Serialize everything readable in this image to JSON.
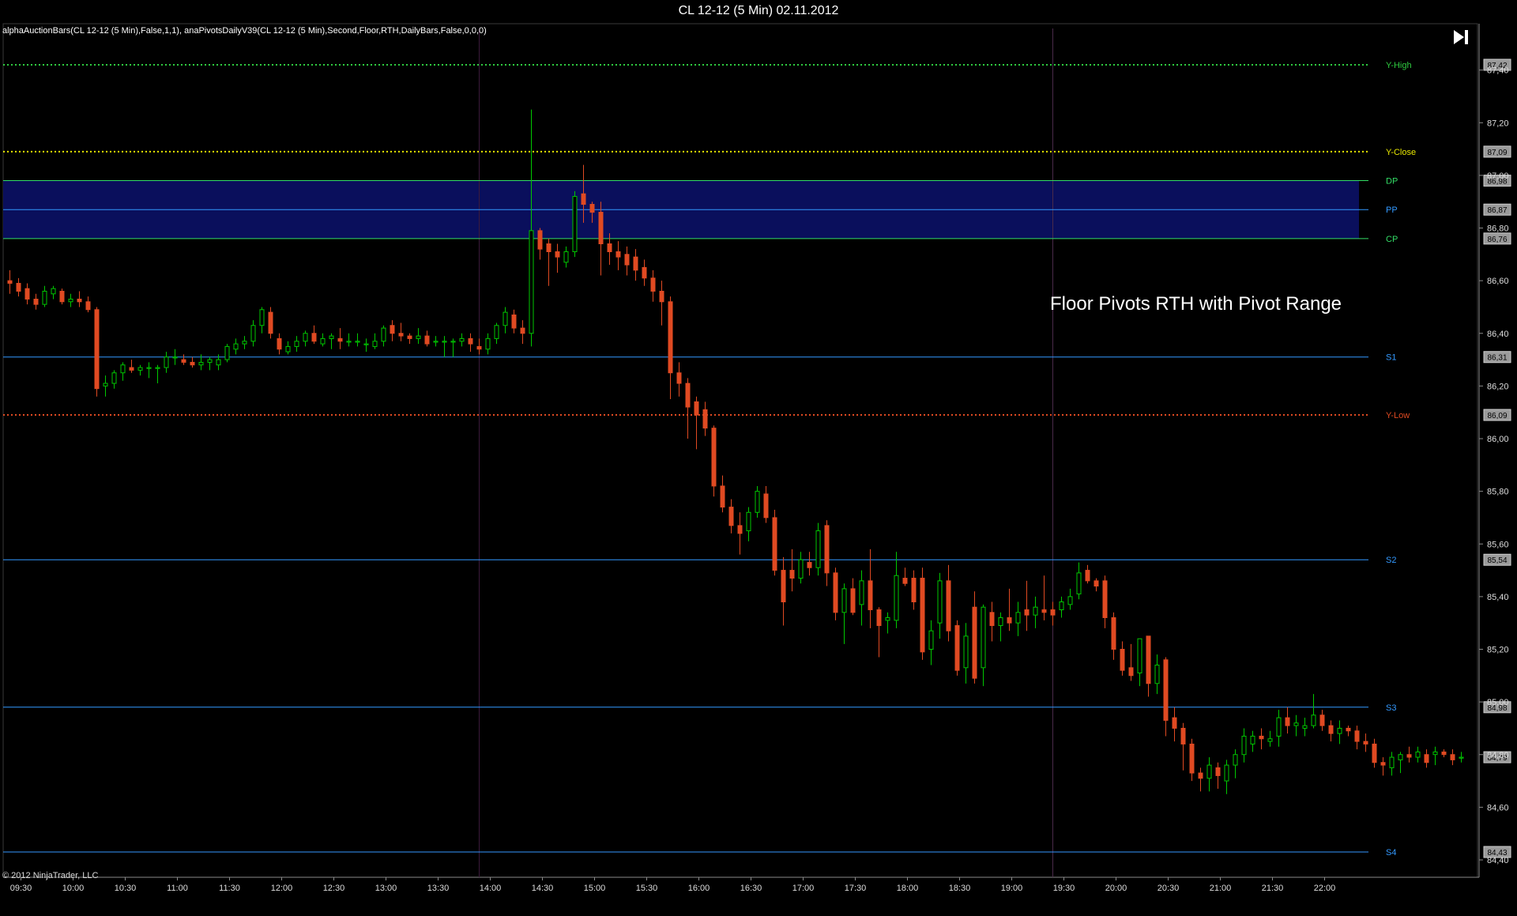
{
  "window": {
    "title": "CL 12-12 (5 Min)  02.11.2012",
    "indicators": "alphaAuctionBars(CL 12-12 (5 Min),False,1,1), anaPivotsDailyV39(CL 12-12 (5 Min),Second,Floor,RTH,DailyBars,False,0,0,0)",
    "copyright": "© 2012 NinjaTrader, LLC",
    "jump_button_icon": "skip-to-end-icon"
  },
  "colors": {
    "background": "#000000",
    "up_candle": "#00c800",
    "down_candle": "#e04a22",
    "pivot_range_fill": "#0a0f5c",
    "grid": "#1a1a1a"
  },
  "chart_data": {
    "type": "candlestick",
    "instrument": "CL 12-12",
    "interval": "5 Min",
    "date": "02.11.2012",
    "title": "CL 12-12 (5 Min)  02.11.2012",
    "annotation": "Floor Pivots RTH with Pivot Range",
    "y_axis": {
      "position": "right",
      "range": [
        84.4,
        87.48
      ],
      "ticks": [
        "87,40",
        "87,20",
        "87,00",
        "86,80",
        "86,60",
        "86,40",
        "86,20",
        "86,00",
        "85,80",
        "85,60",
        "85,40",
        "85,20",
        "85,00",
        "84,80",
        "84,60",
        "84,40"
      ],
      "tick_values": [
        87.4,
        87.2,
        87.0,
        86.8,
        86.6,
        86.4,
        86.2,
        86.0,
        85.8,
        85.6,
        85.4,
        85.2,
        85.0,
        84.8,
        84.6,
        84.4
      ]
    },
    "x_axis": {
      "ticks": [
        "09:30",
        "10:00",
        "10:30",
        "11:00",
        "11:30",
        "12:00",
        "12:30",
        "13:00",
        "13:30",
        "14:00",
        "14:30",
        "15:00",
        "15:30",
        "16:00",
        "16:30",
        "17:00",
        "17:30",
        "18:00",
        "18:30",
        "19:00",
        "19:30",
        "20:00",
        "20:30",
        "21:00",
        "21:30",
        "22:00"
      ],
      "bar_minutes": 5,
      "first_bar": "09:30",
      "last_bar": "22:10",
      "session_lines": [
        "14:00",
        "19:30"
      ]
    },
    "pivot_levels": [
      {
        "label": "Y-High",
        "value": 87.42,
        "price_label": "87,42",
        "color": "#2ecc40",
        "style": "dotted"
      },
      {
        "label": "Y-Close",
        "value": 87.09,
        "price_label": "87,09",
        "color": "#e6e600",
        "style": "dotted"
      },
      {
        "label": "DP",
        "value": 86.98,
        "price_label": "86,98",
        "color": "#33dd66",
        "style": "solid"
      },
      {
        "label": "PP",
        "value": 86.87,
        "price_label": "86,87",
        "color": "#3399ff",
        "style": "solid"
      },
      {
        "label": "CP",
        "value": 86.76,
        "price_label": "86,76",
        "color": "#33dd66",
        "style": "solid"
      },
      {
        "label": "S1",
        "value": 86.31,
        "price_label": "86,31",
        "color": "#3399ff",
        "style": "solid"
      },
      {
        "label": "Y-Low",
        "value": 86.09,
        "price_label": "86,09",
        "color": "#e04a22",
        "style": "dotted"
      },
      {
        "label": "S2",
        "value": 85.54,
        "price_label": "85,54",
        "color": "#3399ff",
        "style": "solid"
      },
      {
        "label": "S3",
        "value": 84.98,
        "price_label": "84,98",
        "color": "#3399ff",
        "style": "solid"
      },
      {
        "label": "S4",
        "value": 84.43,
        "price_label": "84,43",
        "color": "#3399ff",
        "style": "solid"
      }
    ],
    "last_price": {
      "value": 84.79,
      "price_label": "84,79"
    },
    "pivot_range": {
      "top": 86.98,
      "bottom": 86.76
    },
    "candles": [
      [
        86.6,
        86.64,
        86.55,
        86.59
      ],
      [
        86.59,
        86.61,
        86.54,
        86.56
      ],
      [
        86.57,
        86.59,
        86.51,
        86.53
      ],
      [
        86.53,
        86.55,
        86.49,
        86.51
      ],
      [
        86.51,
        86.58,
        86.5,
        86.56
      ],
      [
        86.55,
        86.58,
        86.53,
        86.57
      ],
      [
        86.56,
        86.57,
        86.51,
        86.52
      ],
      [
        86.52,
        86.55,
        86.5,
        86.53
      ],
      [
        86.53,
        86.56,
        86.5,
        86.52
      ],
      [
        86.52,
        86.54,
        86.48,
        86.49
      ],
      [
        86.49,
        86.5,
        86.16,
        86.19
      ],
      [
        86.2,
        86.24,
        86.16,
        86.21
      ],
      [
        86.21,
        86.26,
        86.19,
        86.25
      ],
      [
        86.25,
        86.29,
        86.22,
        86.28
      ],
      [
        86.27,
        86.3,
        86.25,
        86.26
      ],
      [
        86.26,
        86.28,
        86.24,
        86.27
      ],
      [
        86.27,
        86.29,
        86.23,
        86.27
      ],
      [
        86.27,
        86.28,
        86.21,
        86.27
      ],
      [
        86.27,
        86.33,
        86.25,
        86.31
      ],
      [
        86.31,
        86.34,
        86.28,
        86.31
      ],
      [
        86.3,
        86.32,
        86.28,
        86.29
      ],
      [
        86.29,
        86.31,
        86.27,
        86.28
      ],
      [
        86.28,
        86.32,
        86.26,
        86.29
      ],
      [
        86.29,
        86.31,
        86.26,
        86.3
      ],
      [
        86.28,
        86.32,
        86.26,
        86.3
      ],
      [
        86.3,
        86.36,
        86.29,
        86.35
      ],
      [
        86.34,
        86.38,
        86.32,
        86.36
      ],
      [
        86.36,
        86.39,
        86.34,
        86.37
      ],
      [
        86.37,
        86.45,
        86.35,
        86.43
      ],
      [
        86.43,
        86.5,
        86.4,
        86.49
      ],
      [
        86.48,
        86.5,
        86.38,
        86.4
      ],
      [
        86.38,
        86.4,
        86.32,
        86.34
      ],
      [
        86.33,
        86.37,
        86.32,
        86.35
      ],
      [
        86.35,
        86.39,
        86.33,
        86.37
      ],
      [
        86.37,
        86.41,
        86.35,
        86.4
      ],
      [
        86.4,
        86.43,
        86.36,
        86.37
      ],
      [
        86.36,
        86.4,
        86.35,
        86.38
      ],
      [
        86.38,
        86.4,
        86.34,
        86.39
      ],
      [
        86.38,
        86.42,
        86.34,
        86.37
      ],
      [
        86.37,
        86.4,
        86.35,
        86.37
      ],
      [
        86.37,
        86.4,
        86.35,
        86.37
      ],
      [
        86.36,
        86.38,
        86.33,
        86.36
      ],
      [
        86.35,
        86.4,
        86.34,
        86.37
      ],
      [
        86.37,
        86.43,
        86.35,
        86.42
      ],
      [
        86.43,
        86.45,
        86.37,
        86.4
      ],
      [
        86.4,
        86.44,
        86.37,
        86.39
      ],
      [
        86.39,
        86.4,
        86.36,
        86.38
      ],
      [
        86.38,
        86.42,
        86.36,
        86.39
      ],
      [
        86.39,
        86.41,
        86.35,
        86.36
      ],
      [
        86.37,
        86.39,
        86.35,
        86.37
      ],
      [
        86.37,
        86.39,
        86.31,
        86.37
      ],
      [
        86.37,
        86.38,
        86.31,
        86.37
      ],
      [
        86.37,
        86.4,
        86.35,
        86.38
      ],
      [
        86.38,
        86.4,
        86.33,
        86.36
      ],
      [
        86.35,
        86.38,
        86.32,
        86.34
      ],
      [
        86.34,
        86.4,
        86.32,
        86.38
      ],
      [
        86.38,
        86.44,
        86.36,
        86.43
      ],
      [
        86.43,
        86.5,
        86.4,
        86.48
      ],
      [
        86.47,
        86.49,
        86.4,
        86.42
      ],
      [
        86.42,
        86.45,
        86.36,
        86.4
      ],
      [
        86.4,
        87.25,
        86.35,
        86.79
      ],
      [
        86.79,
        86.8,
        86.68,
        86.72
      ],
      [
        86.74,
        86.76,
        86.58,
        86.71
      ],
      [
        86.71,
        86.74,
        86.63,
        86.69
      ],
      [
        86.67,
        86.73,
        86.65,
        86.71
      ],
      [
        86.71,
        86.94,
        86.69,
        86.92
      ],
      [
        86.93,
        87.04,
        86.82,
        86.89
      ],
      [
        86.89,
        86.9,
        86.82,
        86.86
      ],
      [
        86.86,
        86.9,
        86.62,
        86.74
      ],
      [
        86.74,
        86.78,
        86.66,
        86.71
      ],
      [
        86.71,
        86.75,
        86.64,
        86.69
      ],
      [
        86.7,
        86.73,
        86.62,
        86.66
      ],
      [
        86.69,
        86.72,
        86.6,
        86.64
      ],
      [
        86.65,
        86.68,
        86.58,
        86.61
      ],
      [
        86.61,
        86.64,
        86.52,
        86.56
      ],
      [
        86.56,
        86.6,
        86.43,
        86.52
      ],
      [
        86.52,
        86.54,
        86.15,
        86.25
      ],
      [
        86.25,
        86.29,
        86.16,
        86.21
      ],
      [
        86.21,
        86.23,
        86.0,
        86.12
      ],
      [
        86.14,
        86.16,
        85.96,
        86.09
      ],
      [
        86.11,
        86.14,
        86.01,
        86.04
      ],
      [
        86.04,
        86.05,
        85.78,
        85.82
      ],
      [
        85.82,
        85.86,
        85.72,
        85.74
      ],
      [
        85.74,
        85.77,
        85.64,
        85.67
      ],
      [
        85.67,
        85.72,
        85.56,
        85.64
      ],
      [
        85.65,
        85.74,
        85.61,
        85.72
      ],
      [
        85.72,
        85.82,
        85.7,
        85.8
      ],
      [
        85.79,
        85.82,
        85.68,
        85.7
      ],
      [
        85.7,
        85.73,
        85.48,
        85.5
      ],
      [
        85.5,
        85.55,
        85.29,
        85.38
      ],
      [
        85.5,
        85.58,
        85.42,
        85.47
      ],
      [
        85.47,
        85.57,
        85.45,
        85.54
      ],
      [
        85.53,
        85.57,
        85.48,
        85.51
      ],
      [
        85.51,
        85.68,
        85.48,
        85.65
      ],
      [
        85.67,
        85.69,
        85.44,
        85.49
      ],
      [
        85.49,
        85.51,
        85.31,
        85.34
      ],
      [
        85.34,
        85.45,
        85.22,
        85.43
      ],
      [
        85.43,
        85.47,
        85.33,
        85.34
      ],
      [
        85.37,
        85.5,
        85.29,
        85.46
      ],
      [
        85.46,
        85.58,
        85.28,
        85.35
      ],
      [
        85.35,
        85.36,
        85.17,
        85.29
      ],
      [
        85.31,
        85.34,
        85.26,
        85.32
      ],
      [
        85.31,
        85.57,
        85.28,
        85.48
      ],
      [
        85.47,
        85.51,
        85.44,
        85.45
      ],
      [
        85.47,
        85.5,
        85.35,
        85.38
      ],
      [
        85.47,
        85.51,
        85.16,
        85.19
      ],
      [
        85.2,
        85.31,
        85.14,
        85.27
      ],
      [
        85.3,
        85.49,
        85.24,
        85.46
      ],
      [
        85.46,
        85.52,
        85.23,
        85.27
      ],
      [
        85.29,
        85.31,
        85.1,
        85.12
      ],
      [
        85.13,
        85.3,
        85.07,
        85.25
      ],
      [
        85.36,
        85.42,
        85.07,
        85.09
      ],
      [
        85.13,
        85.37,
        85.06,
        85.36
      ],
      [
        85.34,
        85.38,
        85.23,
        85.29
      ],
      [
        85.29,
        85.34,
        85.23,
        85.32
      ],
      [
        85.32,
        85.43,
        85.27,
        85.3
      ],
      [
        85.3,
        85.38,
        85.25,
        85.34
      ],
      [
        85.35,
        85.46,
        85.27,
        85.33
      ],
      [
        85.33,
        85.4,
        85.28,
        85.36
      ],
      [
        85.35,
        85.48,
        85.31,
        85.34
      ],
      [
        85.35,
        85.38,
        85.29,
        85.33
      ],
      [
        85.35,
        85.4,
        85.32,
        85.38
      ],
      [
        85.37,
        85.43,
        85.35,
        85.4
      ],
      [
        85.41,
        85.53,
        85.39,
        85.49
      ],
      [
        85.5,
        85.52,
        85.45,
        85.46
      ],
      [
        85.46,
        85.47,
        85.42,
        85.44
      ],
      [
        85.46,
        85.48,
        85.28,
        85.32
      ],
      [
        85.32,
        85.34,
        85.16,
        85.2
      ],
      [
        85.2,
        85.23,
        85.1,
        85.12
      ],
      [
        85.13,
        85.22,
        85.08,
        85.1
      ],
      [
        85.11,
        85.23,
        85.06,
        85.24
      ],
      [
        85.25,
        85.25,
        85.02,
        85.07
      ],
      [
        85.07,
        85.18,
        85.03,
        85.14
      ],
      [
        85.16,
        85.17,
        84.87,
        84.93
      ],
      [
        84.94,
        84.98,
        84.85,
        84.9
      ],
      [
        84.9,
        84.92,
        84.74,
        84.84
      ],
      [
        84.84,
        84.86,
        84.7,
        84.73
      ],
      [
        84.73,
        84.75,
        84.66,
        84.71
      ],
      [
        84.71,
        84.79,
        84.66,
        84.76
      ],
      [
        84.75,
        84.77,
        84.67,
        84.72
      ],
      [
        84.7,
        84.78,
        84.65,
        84.76
      ],
      [
        84.76,
        84.82,
        84.71,
        84.8
      ],
      [
        84.8,
        84.9,
        84.77,
        84.87
      ],
      [
        84.84,
        84.89,
        84.81,
        84.87
      ],
      [
        84.87,
        84.9,
        84.82,
        84.86
      ],
      [
        84.85,
        84.89,
        84.83,
        84.86
      ],
      [
        84.87,
        84.97,
        84.83,
        84.94
      ],
      [
        84.94,
        84.98,
        84.88,
        84.91
      ],
      [
        84.91,
        84.95,
        84.87,
        84.92
      ],
      [
        84.9,
        84.94,
        84.87,
        84.91
      ],
      [
        84.91,
        85.03,
        84.9,
        84.95
      ],
      [
        84.95,
        84.97,
        84.89,
        84.91
      ],
      [
        84.91,
        84.93,
        84.85,
        84.88
      ],
      [
        84.88,
        84.93,
        84.84,
        84.9
      ],
      [
        84.9,
        84.91,
        84.87,
        84.89
      ],
      [
        84.89,
        84.91,
        84.82,
        84.85
      ],
      [
        84.85,
        84.88,
        84.81,
        84.84
      ],
      [
        84.84,
        84.86,
        84.75,
        84.77
      ],
      [
        84.77,
        84.79,
        84.72,
        84.76
      ],
      [
        84.75,
        84.81,
        84.72,
        84.79
      ],
      [
        84.78,
        84.81,
        84.73,
        84.8
      ],
      [
        84.8,
        84.83,
        84.77,
        84.79
      ],
      [
        84.79,
        84.83,
        84.77,
        84.81
      ],
      [
        84.8,
        84.82,
        84.75,
        84.77
      ],
      [
        84.8,
        84.83,
        84.76,
        84.81
      ],
      [
        84.81,
        84.82,
        84.79,
        84.8
      ],
      [
        84.8,
        84.82,
        84.76,
        84.78
      ],
      [
        84.79,
        84.81,
        84.77,
        84.79
      ]
    ]
  }
}
